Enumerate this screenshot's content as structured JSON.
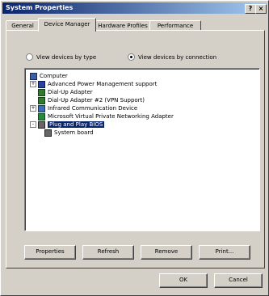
{
  "window": {
    "title": "System Properties",
    "close_glyph": "?|×"
  },
  "tabs": [
    {
      "label": "General"
    },
    {
      "label": "Device Manager"
    },
    {
      "label": "Hardware Profiles"
    },
    {
      "label": "Performance"
    }
  ],
  "view_options": {
    "by_type": "View devices by type",
    "by_connection": "View devices by connection",
    "selected": "by_connection"
  },
  "tree": {
    "items": [
      {
        "label": "Computer",
        "icon": "computer-icon"
      },
      {
        "label": "Advanced Power Management support",
        "icon": "power-management-icon",
        "expander": "+"
      },
      {
        "label": "Dial-Up Adapter",
        "icon": "network-adapter-icon"
      },
      {
        "label": "Dial-Up Adapter #2 (VPN Support)",
        "icon": "network-adapter-icon"
      },
      {
        "label": "Infrared Communication Device",
        "icon": "infrared-icon",
        "expander": "+"
      },
      {
        "label": "Microsoft Virtual Private Networking Adapter",
        "icon": "network-adapter-icon"
      },
      {
        "label": "Plug and Play BIOS",
        "icon": "bios-icon",
        "expander": "-",
        "selected": true
      },
      {
        "label": "System board",
        "icon": "chip-icon"
      }
    ]
  },
  "buttons": {
    "properties": "Properties",
    "refresh": "Refresh",
    "remove": "Remove",
    "print": "Print...",
    "ok": "OK",
    "cancel": "Cancel"
  }
}
